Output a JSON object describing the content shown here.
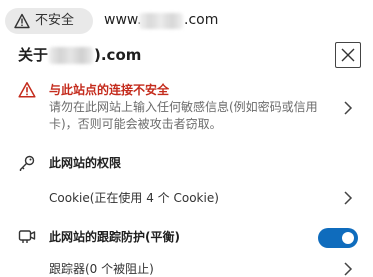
{
  "address_bar": {
    "security_label": "不安全",
    "url_prefix": "www.",
    "url_suffix": ".com"
  },
  "panel": {
    "title_prefix": "关于",
    "title_suffix": ").com",
    "close_icon": "close-icon"
  },
  "warning": {
    "icon": "warning-triangle-icon",
    "title": "与此站点的连接不安全",
    "description": "请勿在此网站上输入任何敏感信息(例如密码或信用卡)，否则可能会被攻击者窃取。",
    "color": "#c42b1c"
  },
  "permissions": {
    "icon": "key-icon",
    "title": "此网站的权限",
    "cookie_label": "Cookie(正在使用 4 个 Cookie)"
  },
  "tracking": {
    "icon": "tracking-icon",
    "title": "此网站的跟踪防护(平衡)",
    "toggle_on": true,
    "toggle_color": "#0f6cbd",
    "trackers_label": "跟踪器(0 个被阻止)"
  }
}
